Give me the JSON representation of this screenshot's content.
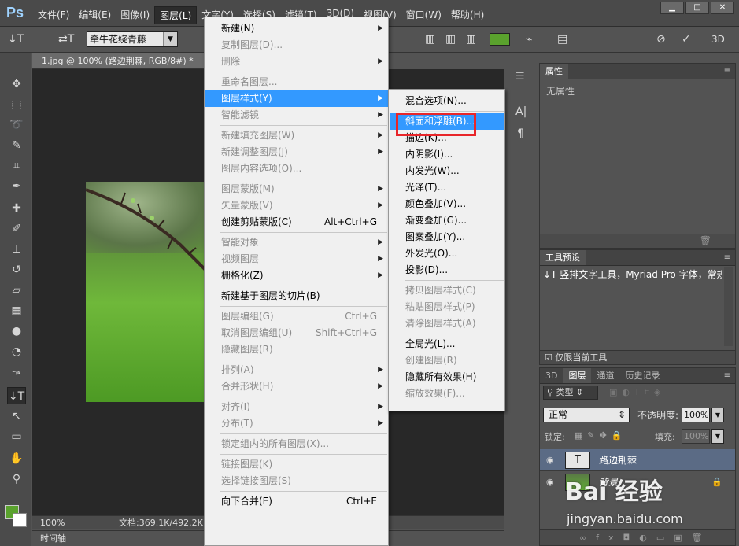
{
  "app": {
    "logo": "Ps"
  },
  "menubar": {
    "items": [
      "文件(F)",
      "编辑(E)",
      "图像(I)",
      "图层(L)",
      "文字(Y)",
      "选择(S)",
      "滤镜(T)",
      "3D(D)",
      "视图(V)",
      "窗口(W)",
      "帮助(H)"
    ],
    "active_index": 3
  },
  "window_controls": {
    "minimize": "▁",
    "restore": "□",
    "close": "✕"
  },
  "options_bar": {
    "font_family": "牵牛花绕青藤",
    "tool_icon": "vertical-type-icon",
    "text_color": "#5aa22d",
    "mode_3d": "3D"
  },
  "document": {
    "tab_title": "1.jpg @ 100% (路边荆棘, RGB/8#) *",
    "zoom": "100%",
    "doc_size": "文档:369.1K/492.2K",
    "timeline_tab": "时间轴"
  },
  "layer_menu": {
    "items": [
      {
        "label": "新建(N)",
        "enabled": true,
        "submenu": true
      },
      {
        "label": "复制图层(D)...",
        "enabled": false
      },
      {
        "label": "删除",
        "enabled": false,
        "submenu": true
      },
      {
        "separator": true
      },
      {
        "label": "重命名图层...",
        "enabled": false
      },
      {
        "label": "图层样式(Y)",
        "enabled": true,
        "submenu": true,
        "highlighted": true
      },
      {
        "label": "智能滤镜",
        "enabled": false,
        "submenu": true
      },
      {
        "separator": true
      },
      {
        "label": "新建填充图层(W)",
        "enabled": false,
        "submenu": true
      },
      {
        "label": "新建调整图层(J)",
        "enabled": false,
        "submenu": true
      },
      {
        "label": "图层内容选项(O)...",
        "enabled": false
      },
      {
        "separator": true
      },
      {
        "label": "图层蒙版(M)",
        "enabled": false,
        "submenu": true
      },
      {
        "label": "矢量蒙版(V)",
        "enabled": false,
        "submenu": true
      },
      {
        "label": "创建剪贴蒙版(C)",
        "enabled": true,
        "shortcut": "Alt+Ctrl+G"
      },
      {
        "separator": true
      },
      {
        "label": "智能对象",
        "enabled": false,
        "submenu": true
      },
      {
        "label": "视频图层",
        "enabled": false,
        "submenu": true
      },
      {
        "label": "栅格化(Z)",
        "enabled": true,
        "submenu": true
      },
      {
        "separator": true
      },
      {
        "label": "新建基于图层的切片(B)",
        "enabled": true
      },
      {
        "separator": true
      },
      {
        "label": "图层编组(G)",
        "enabled": false,
        "shortcut": "Ctrl+G"
      },
      {
        "label": "取消图层编组(U)",
        "enabled": false,
        "shortcut": "Shift+Ctrl+G"
      },
      {
        "label": "隐藏图层(R)",
        "enabled": false
      },
      {
        "separator": true
      },
      {
        "label": "排列(A)",
        "enabled": false,
        "submenu": true
      },
      {
        "label": "合并形状(H)",
        "enabled": false,
        "submenu": true
      },
      {
        "separator": true
      },
      {
        "label": "对齐(I)",
        "enabled": false,
        "submenu": true
      },
      {
        "label": "分布(T)",
        "enabled": false,
        "submenu": true
      },
      {
        "separator": true
      },
      {
        "label": "锁定组内的所有图层(X)...",
        "enabled": false
      },
      {
        "separator": true
      },
      {
        "label": "链接图层(K)",
        "enabled": false
      },
      {
        "label": "选择链接图层(S)",
        "enabled": false
      },
      {
        "separator": true
      },
      {
        "label": "向下合并(E)",
        "enabled": true,
        "shortcut": "Ctrl+E"
      }
    ]
  },
  "style_menu": {
    "items": [
      {
        "label": "混合选项(N)...",
        "enabled": true
      },
      {
        "separator": true
      },
      {
        "label": "斜面和浮雕(B)...",
        "enabled": true,
        "highlighted": true
      },
      {
        "label": "描边(K)...",
        "enabled": true
      },
      {
        "label": "内阴影(I)...",
        "enabled": true
      },
      {
        "label": "内发光(W)...",
        "enabled": true
      },
      {
        "label": "光泽(T)...",
        "enabled": true
      },
      {
        "label": "颜色叠加(V)...",
        "enabled": true
      },
      {
        "label": "渐变叠加(G)...",
        "enabled": true
      },
      {
        "label": "图案叠加(Y)...",
        "enabled": true
      },
      {
        "label": "外发光(O)...",
        "enabled": true
      },
      {
        "label": "投影(D)...",
        "enabled": true
      },
      {
        "separator": true
      },
      {
        "label": "拷贝图层样式(C)",
        "enabled": false
      },
      {
        "label": "粘贴图层样式(P)",
        "enabled": false
      },
      {
        "label": "清除图层样式(A)",
        "enabled": false
      },
      {
        "separator": true
      },
      {
        "label": "全局光(L)...",
        "enabled": true
      },
      {
        "label": "创建图层(R)",
        "enabled": false
      },
      {
        "label": "隐藏所有效果(H)",
        "enabled": true
      },
      {
        "label": "缩放效果(F)...",
        "enabled": false
      }
    ]
  },
  "properties_panel": {
    "tab": "属性",
    "empty_text": "无属性"
  },
  "tool_presets_panel": {
    "tab": "工具预设",
    "preset": "竖排文字工具，Myriad Pro 字体，常规",
    "current_only_label": "仅限当前工具",
    "current_only_checked": true
  },
  "layers_panel": {
    "tabs": [
      "3D",
      "图层",
      "通道",
      "历史记录"
    ],
    "active_tab": "图层",
    "filter_label": "类型",
    "blend_mode": "正常",
    "opacity_label": "不透明度:",
    "opacity": "100%",
    "lock_label": "锁定:",
    "fill_label": "填充:",
    "fill": "100%",
    "layers": [
      {
        "name": "路边荆棘",
        "kind": "text",
        "selected": true
      },
      {
        "name": "背景",
        "kind": "image",
        "selected": false,
        "locked": true
      }
    ]
  },
  "watermark": {
    "logo": "Bai 经验",
    "url": "jingyan.baidu.com"
  }
}
